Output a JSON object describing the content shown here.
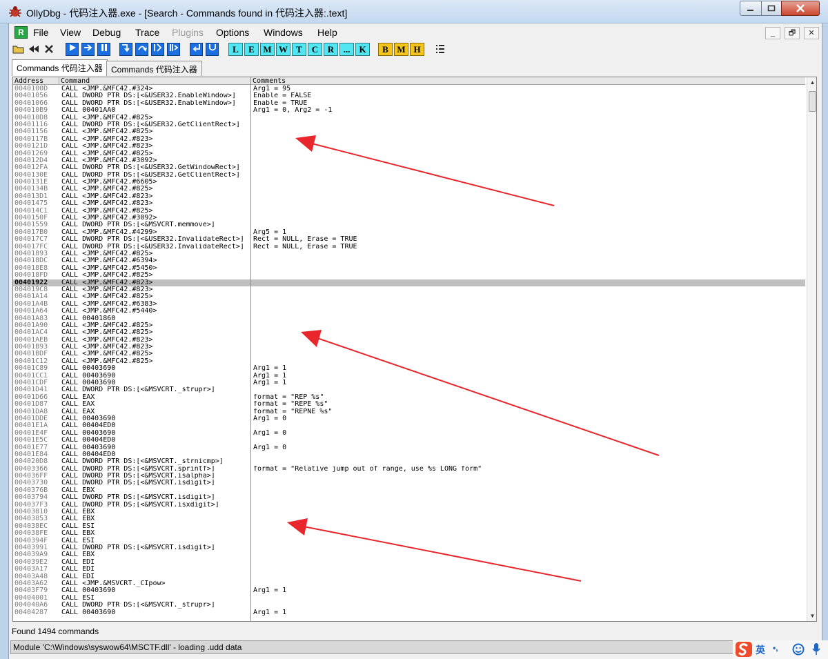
{
  "window": {
    "title": "OllyDbg - 代码注入器.exe - [Search - Commands found in 代码注入器:.text]"
  },
  "menu": {
    "items": [
      "File",
      "View",
      "Debug",
      "Trace",
      "Plugins",
      "Options",
      "Windows",
      "Help"
    ],
    "disabled": "Plugins",
    "mdi_icon": "R"
  },
  "toolbar": {
    "letters": [
      "L",
      "E",
      "M",
      "W",
      "T",
      "C",
      "R",
      "...",
      "K"
    ],
    "letters2": [
      "B",
      "M",
      "H"
    ]
  },
  "tabs": [
    "Commands 代码注入器",
    "Commands 代码注入器"
  ],
  "columns": {
    "address": "Address",
    "command": "Command",
    "comments": "Comments"
  },
  "selected_index": 27,
  "rows": [
    [
      "0040100D",
      "CALL <JMP.&MFC42.#324>",
      "Arg1 = 95"
    ],
    [
      "00401056",
      "CALL DWORD PTR DS:[<&USER32.EnableWindow>]",
      "Enable = FALSE"
    ],
    [
      "00401066",
      "CALL DWORD PTR DS:[<&USER32.EnableWindow>]",
      "Enable = TRUE"
    ],
    [
      "004010B9",
      "CALL 00401AA0",
      "Arg1 = 0, Arg2 = -1"
    ],
    [
      "004010D8",
      "CALL <JMP.&MFC42.#825>",
      ""
    ],
    [
      "00401116",
      "CALL DWORD PTR DS:[<&USER32.GetClientRect>]",
      ""
    ],
    [
      "00401156",
      "CALL <JMP.&MFC42.#825>",
      ""
    ],
    [
      "0040117B",
      "CALL <JMP.&MFC42.#823>",
      ""
    ],
    [
      "0040121D",
      "CALL <JMP.&MFC42.#823>",
      ""
    ],
    [
      "00401269",
      "CALL <JMP.&MFC42.#825>",
      ""
    ],
    [
      "004012D4",
      "CALL <JMP.&MFC42.#3092>",
      ""
    ],
    [
      "004012FA",
      "CALL DWORD PTR DS:[<&USER32.GetWindowRect>]",
      ""
    ],
    [
      "0040130E",
      "CALL DWORD PTR DS:[<&USER32.GetClientRect>]",
      ""
    ],
    [
      "0040131E",
      "CALL <JMP.&MFC42.#6605>",
      ""
    ],
    [
      "0040134B",
      "CALL <JMP.&MFC42.#825>",
      ""
    ],
    [
      "004013D1",
      "CALL <JMP.&MFC42.#823>",
      ""
    ],
    [
      "00401475",
      "CALL <JMP.&MFC42.#823>",
      ""
    ],
    [
      "004014C1",
      "CALL <JMP.&MFC42.#825>",
      ""
    ],
    [
      "0040150F",
      "CALL <JMP.&MFC42.#3092>",
      ""
    ],
    [
      "00401559",
      "CALL DWORD PTR DS:[<&MSVCRT.memmove>]",
      ""
    ],
    [
      "004017B0",
      "CALL <JMP.&MFC42.#4299>",
      "Arg5 = 1"
    ],
    [
      "004017C7",
      "CALL DWORD PTR DS:[<&USER32.InvalidateRect>]",
      "Rect = NULL, Erase = TRUE"
    ],
    [
      "004017FC",
      "CALL DWORD PTR DS:[<&USER32.InvalidateRect>]",
      "Rect = NULL, Erase = TRUE"
    ],
    [
      "00401893",
      "CALL <JMP.&MFC42.#825>",
      ""
    ],
    [
      "004018DC",
      "CALL <JMP.&MFC42.#6394>",
      ""
    ],
    [
      "004018E8",
      "CALL <JMP.&MFC42.#5450>",
      ""
    ],
    [
      "004018FD",
      "CALL <JMP.&MFC42.#825>",
      ""
    ],
    [
      "00401922",
      "CALL <JMP.&MFC42.#823>",
      ""
    ],
    [
      "004019C8",
      "CALL <JMP.&MFC42.#823>",
      ""
    ],
    [
      "00401A14",
      "CALL <JMP.&MFC42.#825>",
      ""
    ],
    [
      "00401A4B",
      "CALL <JMP.&MFC42.#6383>",
      ""
    ],
    [
      "00401A64",
      "CALL <JMP.&MFC42.#5440>",
      ""
    ],
    [
      "00401A83",
      "CALL 00401860",
      ""
    ],
    [
      "00401A90",
      "CALL <JMP.&MFC42.#825>",
      ""
    ],
    [
      "00401AC4",
      "CALL <JMP.&MFC42.#825>",
      ""
    ],
    [
      "00401AEB",
      "CALL <JMP.&MFC42.#823>",
      ""
    ],
    [
      "00401B93",
      "CALL <JMP.&MFC42.#823>",
      ""
    ],
    [
      "00401BDF",
      "CALL <JMP.&MFC42.#825>",
      ""
    ],
    [
      "00401C12",
      "CALL <JMP.&MFC42.#825>",
      ""
    ],
    [
      "00401C89",
      "CALL 00403690",
      "Arg1 = 1"
    ],
    [
      "00401CC1",
      "CALL 00403690",
      "Arg1 = 1"
    ],
    [
      "00401CDF",
      "CALL 00403690",
      "Arg1 = 1"
    ],
    [
      "00401D41",
      "CALL DWORD PTR DS:[<&MSVCRT._strupr>]",
      ""
    ],
    [
      "00401D66",
      "CALL EAX",
      "format = \"REP %s\""
    ],
    [
      "00401D87",
      "CALL EAX",
      "format = \"REPE %s\""
    ],
    [
      "00401DA8",
      "CALL EAX",
      "format = \"REPNE %s\""
    ],
    [
      "00401DDE",
      "CALL 00403690",
      "Arg1 = 0"
    ],
    [
      "00401E1A",
      "CALL 00404ED0",
      ""
    ],
    [
      "00401E4F",
      "CALL 00403690",
      "Arg1 = 0"
    ],
    [
      "00401E5C",
      "CALL 00404ED0",
      ""
    ],
    [
      "00401E77",
      "CALL 00403690",
      "Arg1 = 0"
    ],
    [
      "00401E84",
      "CALL 00404ED0",
      ""
    ],
    [
      "004020D8",
      "CALL DWORD PTR DS:[<&MSVCRT._strnicmp>]",
      ""
    ],
    [
      "00403366",
      "CALL DWORD PTR DS:[<&MSVCRT.sprintf>]",
      "format = \"Relative jump out of range, use %s LONG form\""
    ],
    [
      "004036FF",
      "CALL DWORD PTR DS:[<&MSVCRT.isalpha>]",
      ""
    ],
    [
      "00403730",
      "CALL DWORD PTR DS:[<&MSVCRT.isdigit>]",
      ""
    ],
    [
      "0040376B",
      "CALL EBX",
      ""
    ],
    [
      "00403794",
      "CALL DWORD PTR DS:[<&MSVCRT.isdigit>]",
      ""
    ],
    [
      "004037F3",
      "CALL DWORD PTR DS:[<&MSVCRT.isxdigit>]",
      ""
    ],
    [
      "00403810",
      "CALL EBX",
      ""
    ],
    [
      "00403853",
      "CALL EBX",
      ""
    ],
    [
      "004038EC",
      "CALL ESI",
      ""
    ],
    [
      "004038FE",
      "CALL EBX",
      ""
    ],
    [
      "0040394F",
      "CALL ESI",
      ""
    ],
    [
      "00403991",
      "CALL DWORD PTR DS:[<&MSVCRT.isdigit>]",
      ""
    ],
    [
      "004039A9",
      "CALL EBX",
      ""
    ],
    [
      "004039E2",
      "CALL EDI",
      ""
    ],
    [
      "00403A17",
      "CALL EDI",
      ""
    ],
    [
      "00403A48",
      "CALL EDI",
      ""
    ],
    [
      "00403A62",
      "CALL <JMP.&MSVCRT._CIpow>",
      ""
    ],
    [
      "00403F79",
      "CALL 00403690",
      "Arg1 = 1"
    ],
    [
      "00404001",
      "CALL ESI",
      ""
    ],
    [
      "004040A6",
      "CALL DWORD PTR DS:[<&MSVCRT._strupr>]",
      ""
    ],
    [
      "00404287",
      "CALL 00403690",
      "Arg1 = 1"
    ]
  ],
  "status": {
    "found": "Found 1494 commands",
    "module": "Module 'C:\\Windows\\syswow64\\MSCTF.dll' - loading .udd data"
  },
  "tray": {
    "ime": "英"
  },
  "colors": {
    "annotation_arrow": "#e8262b",
    "selected_row": "#c0c0c0"
  },
  "icons": [
    "ollydbg-bug-icon",
    "minimize-icon",
    "maximize-icon",
    "close-icon",
    "open-icon",
    "rewind-icon",
    "stop-icon",
    "run-icon",
    "step-icon",
    "pause-icon",
    "step-into-icon",
    "step-over-icon",
    "trace-into-icon",
    "trace-over-icon",
    "execute-till-return-icon",
    "go-to-user-icon",
    "list-icon",
    "sogou-s-icon",
    "smile-icon",
    "microphone-icon"
  ]
}
